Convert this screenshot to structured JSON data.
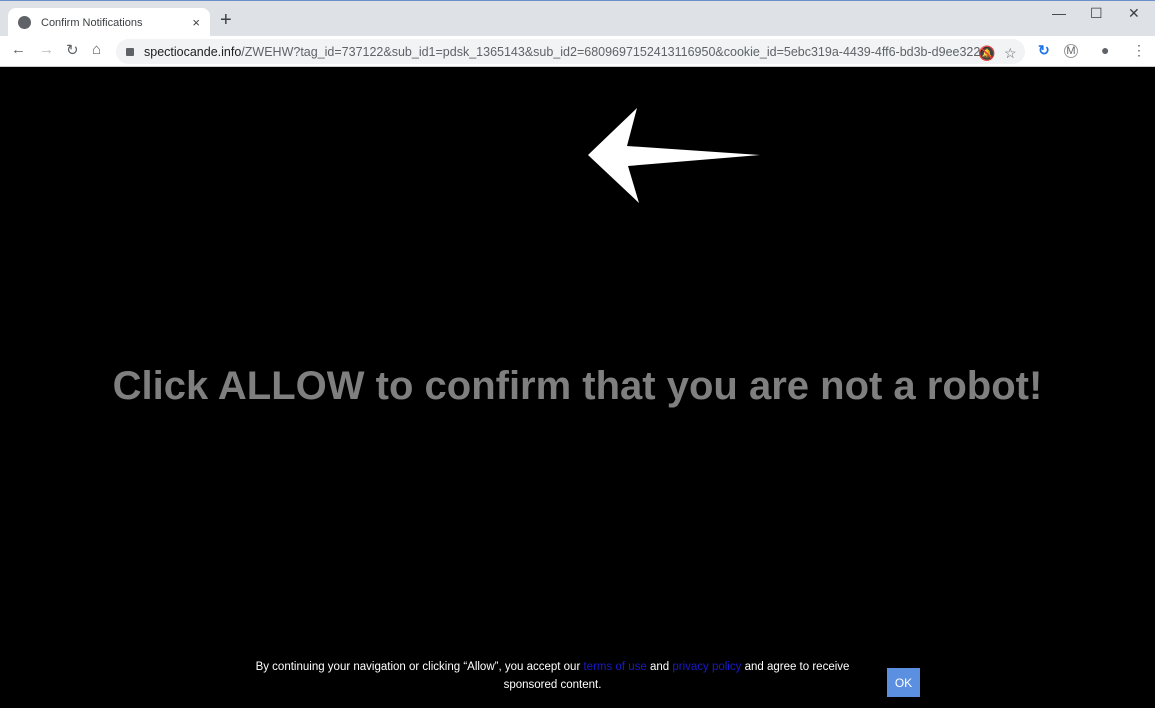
{
  "browser": {
    "tab_title": "Confirm Notifications",
    "tab_close": "×",
    "new_tab": "+",
    "url_host": "spectiocande.info",
    "url_path": "/ZWEHW?tag_id=737122&sub_id1=pdsk_1365143&sub_id2=6809697152413116950&cookie_id=5ebc319a-4439-4ff6-bd3b-d9ee32206d7...",
    "extension_initial": "M"
  },
  "page": {
    "headline": "Click ALLOW to confirm that you are not a robot!",
    "footer_before": "By continuing your navigation or clicking “Allow”, you accept our ",
    "terms_link": "terms of use",
    "and": " and ",
    "privacy_link": "privacy policy",
    "footer_after": " and agree to receive sponsored content.",
    "ok_label": "OK",
    "link_color": "#1a1ac8",
    "ok_color": "#5b8fe0"
  }
}
